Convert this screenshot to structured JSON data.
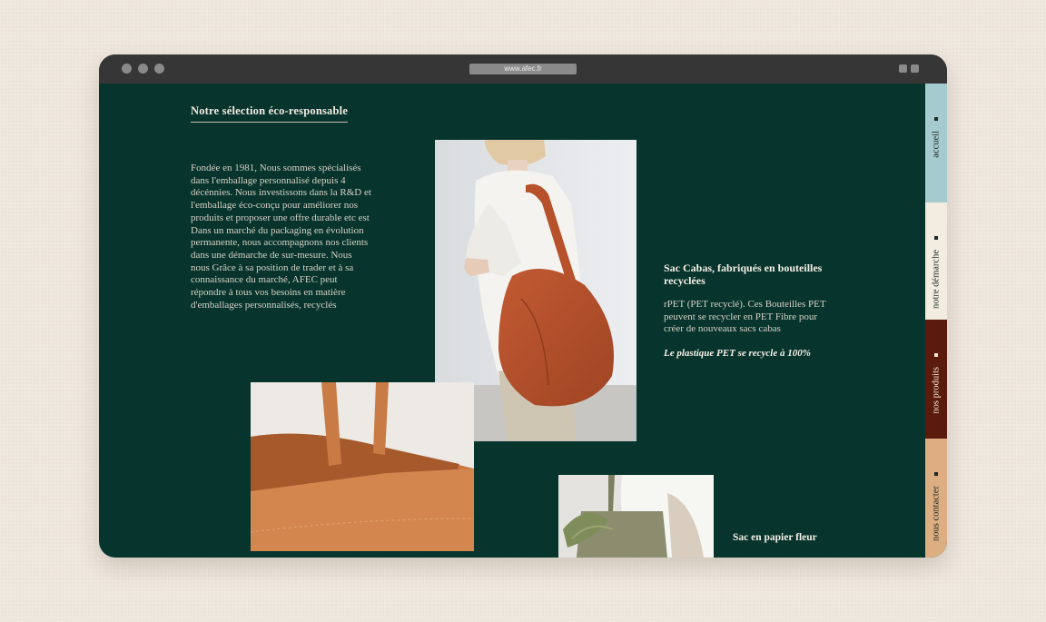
{
  "browser": {
    "url": "www.afec.fr"
  },
  "main": {
    "section_title": "Notre sélection éco-responsable",
    "intro_text": "Fondée en 1981, Nous sommes spécialisés dans l'emballage personnalisé depuis 4 décénnies.  Nous investissons dans la R&D et l'emballage éco-conçu pour améliorer nos produits et proposer une offre durable etc est Dans un marché du packaging en évolution permanente, nous accompagnons nos clients dans une démarche de sur-mesure. Nous nous Grâce à sa position de trader et à sa connaissance du marché, AFEC peut répondre à tous vos besoins en matière d'emballages personnalisés, recyclés"
  },
  "products": {
    "cabas_title": "Sac Cabas, fabriqués en bouteilles recyclées",
    "cabas_description": "rPET (PET recyclé). Ces Bouteilles PET peuvent se recycler en PET Fibre pour créer de nouveaux sacs cabas",
    "cabas_note": "Le plastique PET se recycle à 100%",
    "paper_title": "Sac en papier fleur"
  },
  "nav": {
    "items": [
      {
        "label": "accueil",
        "color": "#a5cbcf"
      },
      {
        "label": "notre démarche",
        "color": "#f3ede1"
      },
      {
        "label": "nos produits",
        "color": "#5a1a0c"
      },
      {
        "label": "nous contacter",
        "color": "#dcae82"
      }
    ]
  },
  "colors": {
    "page_background": "#efe8df",
    "site_background": "#07342d",
    "titlebar": "#363636"
  }
}
